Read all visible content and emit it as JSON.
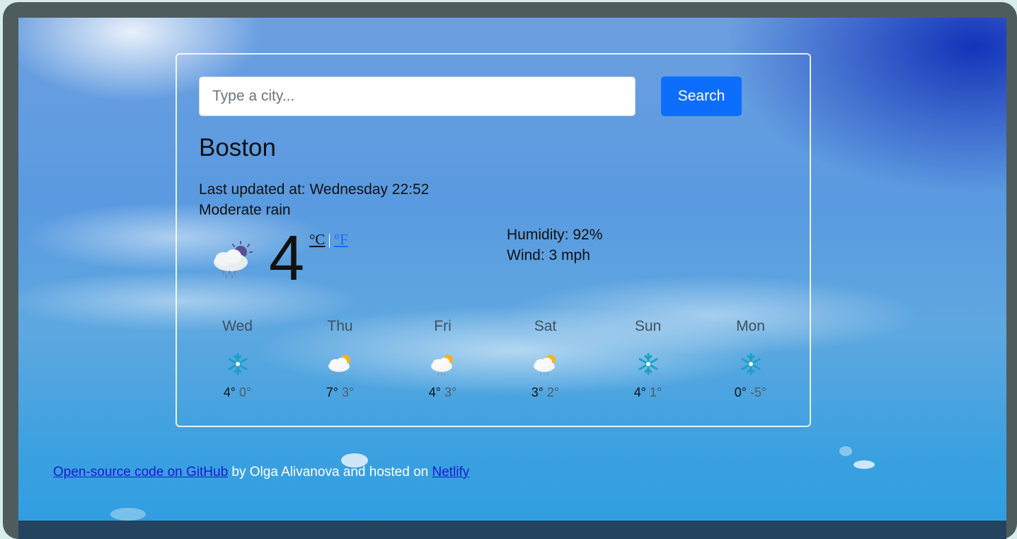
{
  "search": {
    "placeholder": "Type a city...",
    "button_label": "Search"
  },
  "current": {
    "city": "Boston",
    "last_updated": "Last updated at: Wednesday 22:52",
    "description": "Moderate rain",
    "icon": "rain-sun-icon",
    "temperature": "4",
    "unit_celsius": "°C",
    "unit_separator": "|",
    "unit_fahrenheit": "°F",
    "humidity": "Humidity: 92%",
    "wind": "Wind: 3 mph"
  },
  "forecast": [
    {
      "day": "Wed",
      "icon": "snowflake-icon",
      "max": "4°",
      "min": "0°"
    },
    {
      "day": "Thu",
      "icon": "rain-sun-icon",
      "max": "7°",
      "min": "3°"
    },
    {
      "day": "Fri",
      "icon": "rain-sun-icon",
      "max": "4°",
      "min": "3°"
    },
    {
      "day": "Sat",
      "icon": "rain-sun-icon",
      "max": "3°",
      "min": "2°"
    },
    {
      "day": "Sun",
      "icon": "snowflake-icon",
      "max": "4°",
      "min": "1°"
    },
    {
      "day": "Mon",
      "icon": "snowflake-icon",
      "max": "0°",
      "min": "-5°"
    }
  ],
  "footer": {
    "github_link": "Open-source code on GitHub",
    "middle_text": " by Olga Alivanova and hosted on ",
    "netlify_link": "Netlify"
  },
  "colors": {
    "primary": "#0d6efd",
    "link": "#1a1ad0"
  }
}
